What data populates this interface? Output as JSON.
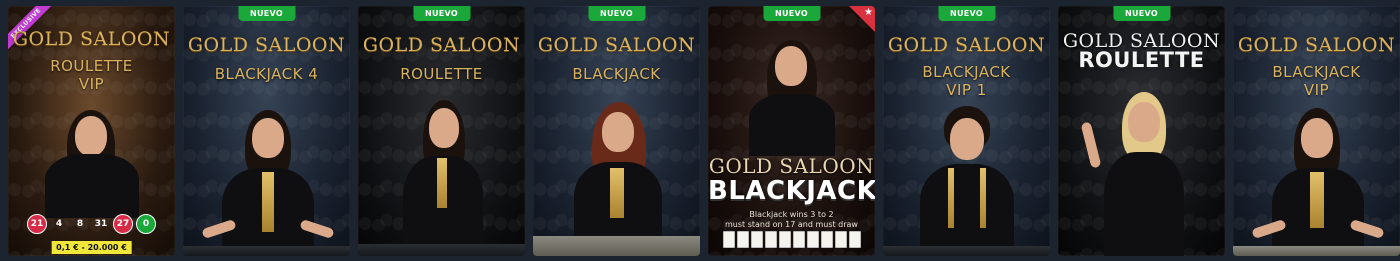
{
  "games": [
    {
      "title": "GOLD SALOON",
      "subtitle_lines": [
        "ROULETTE",
        "VIP"
      ],
      "badge": "EXCLUSIVE",
      "numbers": [
        {
          "value": "21",
          "color": "red"
        },
        {
          "value": "4",
          "color": "black"
        },
        {
          "value": "8",
          "color": "black"
        },
        {
          "value": "31",
          "color": "black"
        },
        {
          "value": "27",
          "color": "red"
        },
        {
          "value": "0",
          "color": "green"
        }
      ],
      "bet_limit": "0,1 € - 20.000 €"
    },
    {
      "title": "GOLD SALOON",
      "subtitle_lines": [
        "BLACKJACK 4"
      ],
      "badge": "NUEVO"
    },
    {
      "title": "GOLD SALOON",
      "subtitle_lines": [
        "ROULETTE"
      ],
      "badge": "NUEVO"
    },
    {
      "title": "GOLD SALOON",
      "subtitle_lines": [
        "BLACKJACK"
      ],
      "badge": "NUEVO"
    },
    {
      "badge": "NUEVO",
      "star_icon": "star-icon",
      "big_title_line1": "GOLD SALOON",
      "big_title_line2": "BLACKJACK",
      "rule_text": "Blackjack wins 3 to 2",
      "rule_text2": "must stand on 17 and must draw"
    },
    {
      "title": "GOLD SALOON",
      "subtitle_lines": [
        "BLACKJACK",
        "VIP 1"
      ],
      "badge": "NUEVO"
    },
    {
      "title": "GOLD SALOON",
      "subtitle_lines": [
        "ROULETTE"
      ],
      "badge": "NUEVO"
    },
    {
      "title": "GOLD SALOON",
      "subtitle_lines": [
        "BLACKJACK",
        "VIP"
      ]
    }
  ],
  "colors": {
    "gold": "#d9b25f",
    "new_badge": "#1aa83a",
    "exclusive": "#c23bd4",
    "red_number": "#d62c47",
    "limit_bg": "#f1e73a"
  }
}
